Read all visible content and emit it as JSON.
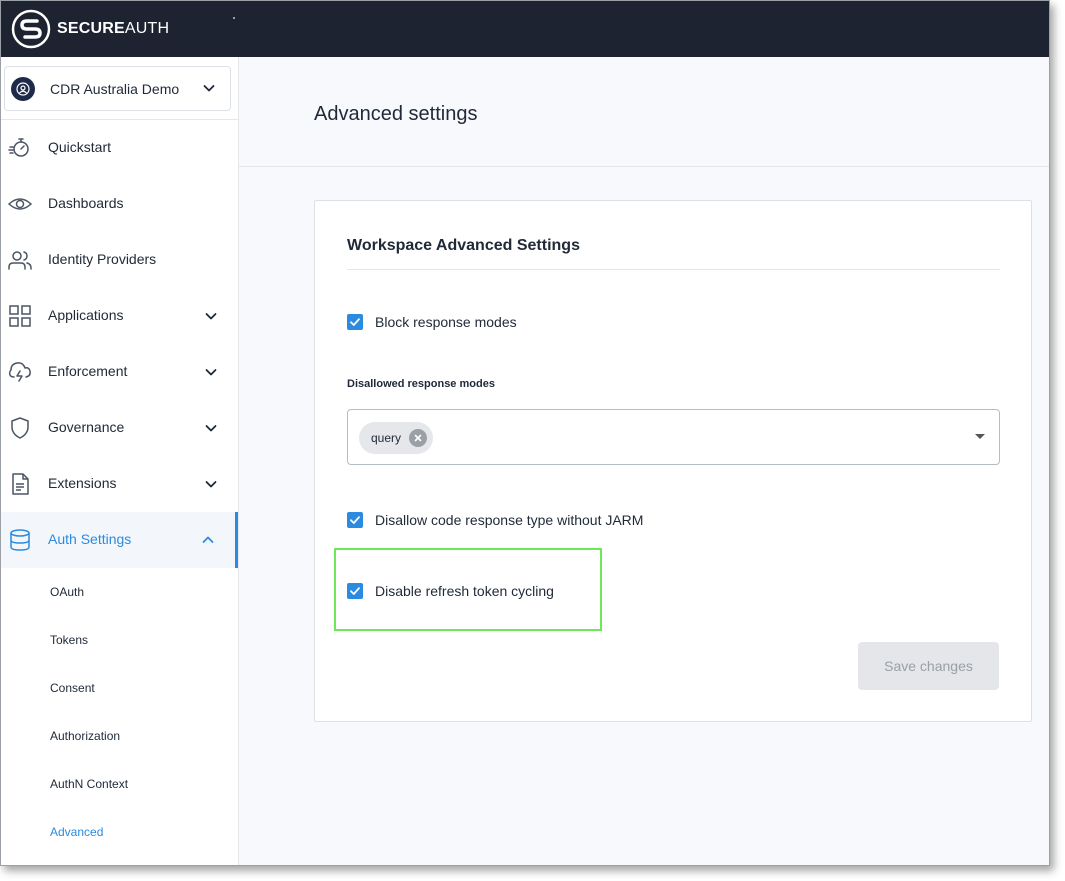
{
  "brand": {
    "name_bold": "SECURE",
    "name_regular": "AUTH"
  },
  "workspace": {
    "name": "CDR Australia Demo"
  },
  "nav": {
    "items": [
      {
        "label": "Quickstart",
        "icon": "stopwatch-icon"
      },
      {
        "label": "Dashboards",
        "icon": "eye-icon"
      },
      {
        "label": "Identity Providers",
        "icon": "users-icon"
      },
      {
        "label": "Applications",
        "icon": "grid-icon",
        "expandable": true
      },
      {
        "label": "Enforcement",
        "icon": "cloud-lightning-icon",
        "expandable": true
      },
      {
        "label": "Governance",
        "icon": "shield-icon",
        "expandable": true
      },
      {
        "label": "Extensions",
        "icon": "document-icon",
        "expandable": true
      },
      {
        "label": "Auth Settings",
        "icon": "database-icon",
        "expandable": true,
        "active": true
      }
    ],
    "sub_items": [
      {
        "label": "OAuth"
      },
      {
        "label": "Tokens"
      },
      {
        "label": "Consent"
      },
      {
        "label": "Authorization"
      },
      {
        "label": "AuthN Context"
      },
      {
        "label": "Advanced",
        "active": true
      }
    ]
  },
  "page": {
    "title": "Advanced settings"
  },
  "card": {
    "title": "Workspace Advanced Settings",
    "block_response_modes": {
      "label": "Block response modes",
      "checked": true
    },
    "disallowed_modes": {
      "label": "Disallowed response modes",
      "selected": [
        "query"
      ]
    },
    "disallow_code_without_jarm": {
      "label": "Disallow code response type without JARM",
      "checked": true
    },
    "disable_refresh_token_cycling": {
      "label": "Disable refresh token cycling",
      "checked": true
    },
    "save_label": "Save changes"
  },
  "colors": {
    "accent": "#2a8be0",
    "topbar": "#1d2330",
    "highlight": "#6ee85a"
  }
}
